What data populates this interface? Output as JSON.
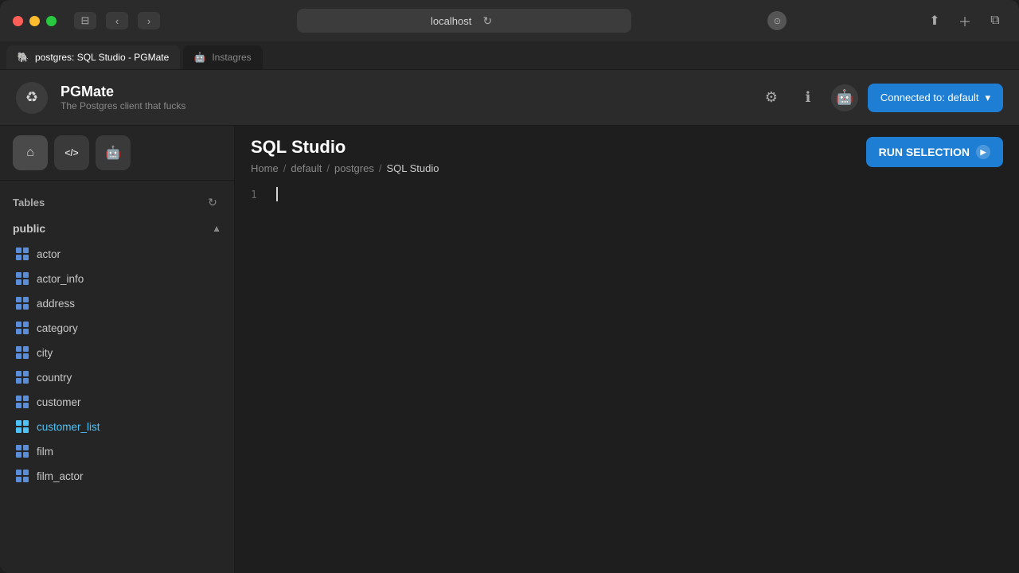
{
  "window": {
    "title": "localhost",
    "mode": "Private"
  },
  "tabs": [
    {
      "id": "postgres-tab",
      "label": "postgres: SQL Studio - PGMate",
      "icon": "🐘",
      "active": true
    },
    {
      "id": "instagres-tab",
      "label": "Instagres",
      "icon": "🤖",
      "active": false
    }
  ],
  "app": {
    "name": "PGMate",
    "subtitle": "The Postgres client that fucks",
    "logo": "♻",
    "connection": "Connected to: default"
  },
  "sidebar": {
    "nav_buttons": [
      {
        "id": "home",
        "icon": "⌂",
        "label": "home-button"
      },
      {
        "id": "code",
        "icon": "</>",
        "label": "code-button"
      },
      {
        "id": "robot",
        "icon": "🤖",
        "label": "robot-button"
      }
    ],
    "tables_label": "Tables",
    "schema": {
      "name": "public",
      "expanded": true
    },
    "tables": [
      {
        "name": "actor",
        "highlighted": false
      },
      {
        "name": "actor_info",
        "highlighted": false
      },
      {
        "name": "address",
        "highlighted": false
      },
      {
        "name": "category",
        "highlighted": false
      },
      {
        "name": "city",
        "highlighted": false
      },
      {
        "name": "country",
        "highlighted": true
      },
      {
        "name": "customer",
        "highlighted": false
      },
      {
        "name": "customer_list",
        "highlighted": true
      },
      {
        "name": "film",
        "highlighted": false
      },
      {
        "name": "film_actor",
        "highlighted": false
      }
    ]
  },
  "editor": {
    "title": "SQL Studio",
    "breadcrumb": [
      "Home",
      "default",
      "postgres",
      "SQL Studio"
    ],
    "run_button_label": "RUN SELECTION",
    "line_numbers": [
      "1"
    ],
    "content": ""
  }
}
